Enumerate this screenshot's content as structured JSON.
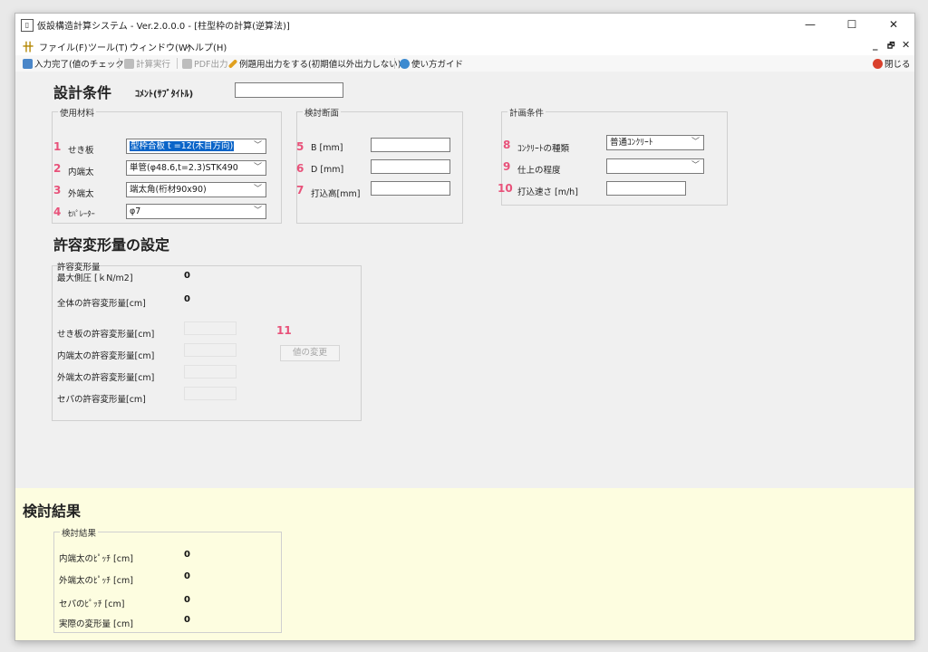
{
  "window": {
    "title": "仮設構造計算システム - Ver.2.0.0.0 - [柱型枠の計算(逆算法)]",
    "controls": [
      "—",
      "☐",
      "✕"
    ],
    "mdi_controls": [
      "_",
      "🗗",
      "✕"
    ]
  },
  "menu": {
    "items": [
      "ファイル(F)",
      "ツール(T)",
      "ウィンドウ(W)",
      "ヘルプ(H)"
    ]
  },
  "toolbar": {
    "input_done": "入力完了(値のチェック)",
    "calc_run": "計算実行",
    "pdf_out": "PDF出力",
    "example_out": "例題用出力をする(初期値以外出力しない)",
    "guide": "使い方ガイド",
    "close": "閉じる"
  },
  "design": {
    "heading": "設計条件",
    "comment_label": "ｺﾒﾝﾄ(ｻﾌﾞﾀｲﾄﾙ)",
    "comment_value": "",
    "materials": {
      "title": "使用材料",
      "rows": [
        {
          "num": "1",
          "label": "せき板",
          "value": "型枠合板 t =12(木目方向)",
          "selected": true
        },
        {
          "num": "2",
          "label": "内端太",
          "value": "単管(φ48.6,t=2.3)STK490",
          "selected": false
        },
        {
          "num": "3",
          "label": "外端太",
          "value": "端太角(桁材90x90)",
          "selected": false
        },
        {
          "num": "4",
          "label": "ｾﾊﾟﾚｰﾀｰ",
          "value": "φ7",
          "selected": false
        }
      ]
    },
    "section": {
      "title": "検討断面",
      "rows": [
        {
          "num": "5",
          "label": "B  [mm]",
          "value": ""
        },
        {
          "num": "6",
          "label": "D [mm]",
          "value": ""
        },
        {
          "num": "7",
          "label": "打込高[mm]",
          "value": ""
        }
      ]
    },
    "plan": {
      "title": "計画条件",
      "rows": [
        {
          "num": "8",
          "label": "ｺﾝｸﾘｰﾄの種類",
          "value": "普通ｺﾝｸﾘｰﾄ",
          "type": "combo"
        },
        {
          "num": "9",
          "label": "仕上の程度",
          "value": "",
          "type": "combo"
        },
        {
          "num": "10",
          "label": "打込速さ  [m/h]",
          "value": "",
          "type": "text"
        }
      ]
    }
  },
  "allowable": {
    "heading": "許容変形量の設定",
    "group_title": "許容変形量",
    "max_pressure_label": "最大側圧  [ｋN/m2]",
    "max_pressure_value": "0",
    "total_label": "全体の許容変形量[cm]",
    "total_value": "0",
    "num": "11",
    "rows": [
      "せき板の許容変形量[cm]",
      "内端太の許容変形量[cm]",
      "外端太の許容変形量[cm]",
      "セパの許容変形量[cm]"
    ],
    "change_button": "値の変更"
  },
  "results": {
    "heading": "検討結果",
    "group_title": "検討結果",
    "rows": [
      {
        "label": "内端太のﾋﾟｯﾁ  [cm]",
        "value": "0"
      },
      {
        "label": "外端太のﾋﾟｯﾁ  [cm]",
        "value": "0"
      },
      {
        "label": "セパのﾋﾟｯﾁ  [cm]",
        "value": "0"
      },
      {
        "label": "実際の変形量  [cm]",
        "value": "0"
      }
    ]
  },
  "colors": {
    "number_accent": "#e8527a",
    "results_bg": "#fdfde0",
    "selection": "#0a64c8"
  }
}
